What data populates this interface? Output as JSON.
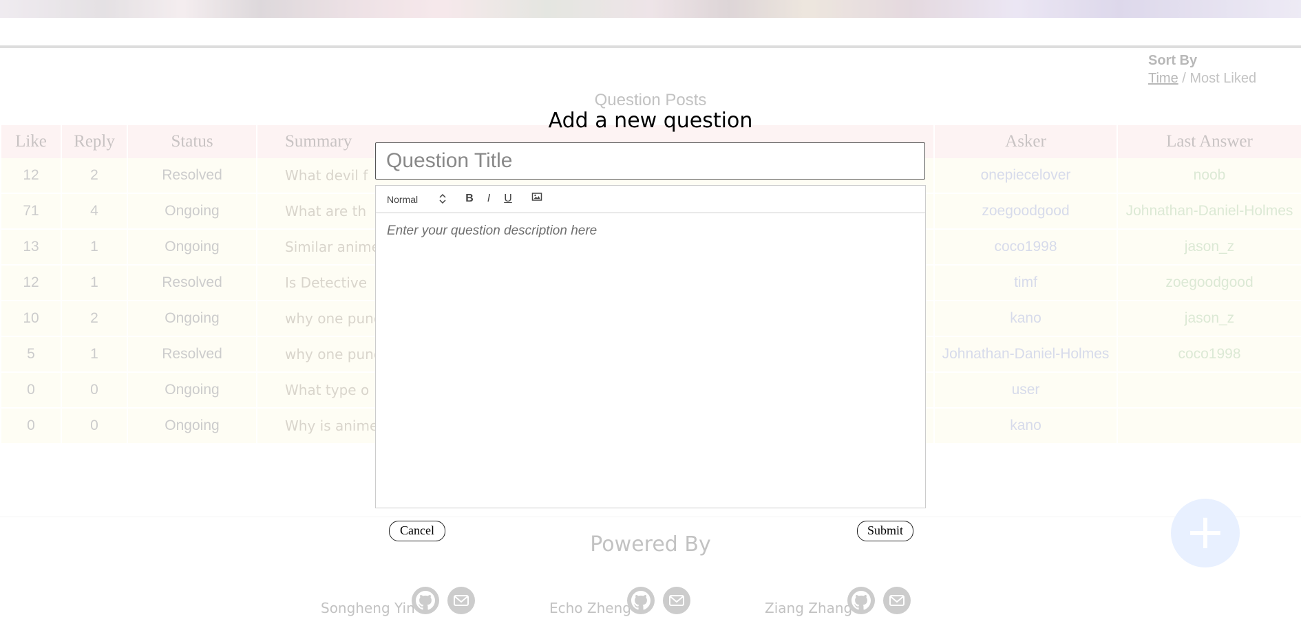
{
  "sort": {
    "title": "Sort By",
    "time": "Time",
    "sep": " / ",
    "most_liked": "Most Liked"
  },
  "posts_title": "Question Posts",
  "table": {
    "headers": {
      "like": "Like",
      "reply": "Reply",
      "status": "Status",
      "summary": "Summary",
      "asker": "Asker",
      "last_answer": "Last Answer"
    },
    "rows": [
      {
        "like": "12",
        "reply": "2",
        "status": "Resolved",
        "summary": "What devil f",
        "asker": "onepiecelover",
        "last": "noob"
      },
      {
        "like": "71",
        "reply": "4",
        "status": "Ongoing",
        "summary": "What are th",
        "asker": "zoegoodgood",
        "last": "Johnathan-Daniel-Holmes"
      },
      {
        "like": "13",
        "reply": "1",
        "status": "Ongoing",
        "summary": "Similar anime",
        "asker": "coco1998",
        "last": "jason_z"
      },
      {
        "like": "12",
        "reply": "1",
        "status": "Resolved",
        "summary": "Is Detective",
        "asker": "timf",
        "last": "zoegoodgood"
      },
      {
        "like": "10",
        "reply": "2",
        "status": "Ongoing",
        "summary": "why one punc",
        "asker": "kano",
        "last": "jason_z"
      },
      {
        "like": "5",
        "reply": "1",
        "status": "Resolved",
        "summary": "why one punc",
        "asker": "Johnathan-Daniel-Holmes",
        "last": "coco1998"
      },
      {
        "like": "0",
        "reply": "0",
        "status": "Ongoing",
        "summary": "What type o",
        "asker": "user",
        "last": ""
      },
      {
        "like": "0",
        "reply": "0",
        "status": "Ongoing",
        "summary": "Why is anime",
        "asker": "kano",
        "last": ""
      }
    ]
  },
  "fab": {
    "icon": "plus-icon",
    "glyph": "+"
  },
  "footer": {
    "powered_by": "Powered By",
    "authors": [
      {
        "name": "Songheng Yin",
        "icons": [
          "github-icon",
          "mail-icon"
        ]
      },
      {
        "name": "Echo Zheng",
        "icons": [
          "github-icon",
          "mail-icon"
        ]
      },
      {
        "name": "Ziang Zhang",
        "icons": [
          "github-icon",
          "mail-icon"
        ]
      }
    ]
  },
  "modal": {
    "title": "Add a new question",
    "title_placeholder": "Question Title",
    "format_select": "Normal",
    "toolbar": {
      "bold": "B",
      "italic": "I",
      "underline": "U",
      "image_icon": "image-icon"
    },
    "description_placeholder": "Enter your question description here",
    "cancel": "Cancel",
    "submit": "Submit"
  },
  "colors": {
    "header_bg": "#fdeeee",
    "row_bg": "#fefcf0",
    "asker": "#c6cce2",
    "last_answer": "#cde0c3",
    "fab": "#dfeaff"
  }
}
